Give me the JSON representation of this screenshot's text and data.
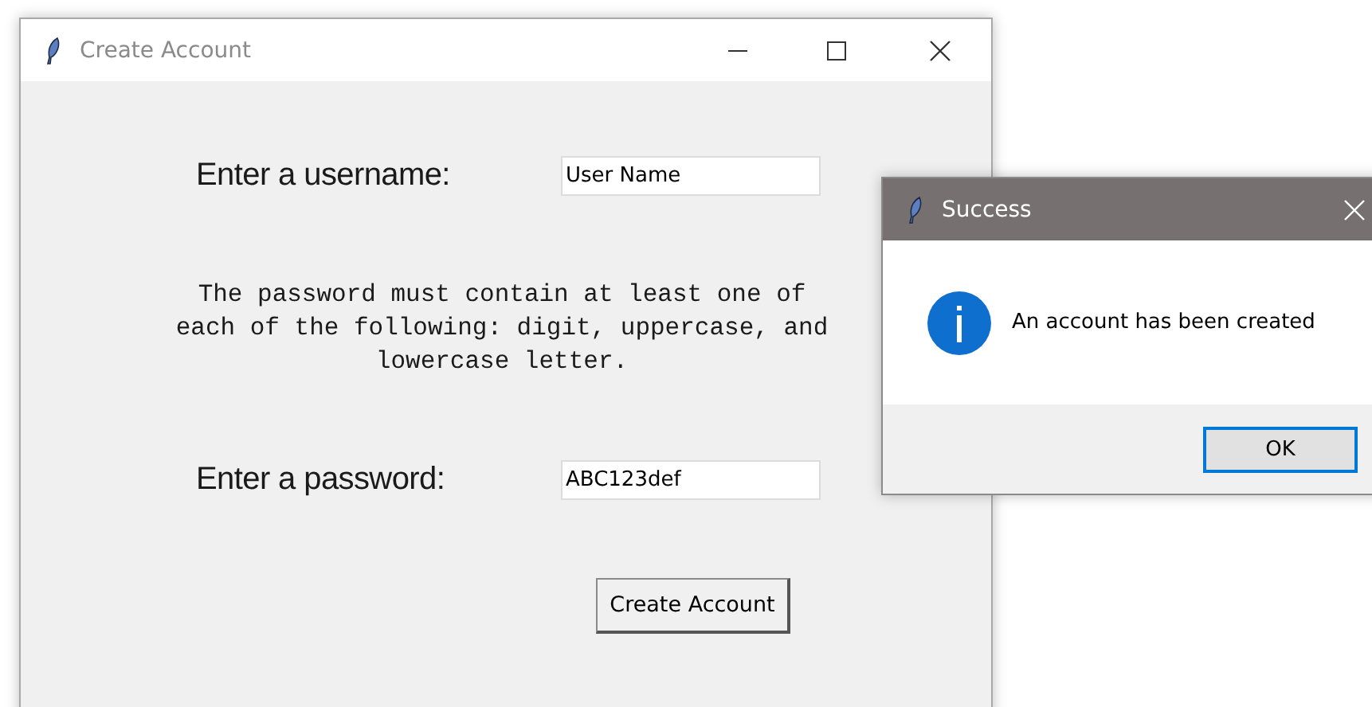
{
  "main_window": {
    "title": "Create Account",
    "active": false,
    "fields": [
      {
        "label": "Enter a username:",
        "value": "User Name"
      },
      {
        "label": "Enter a password:",
        "value": "ABC123def"
      }
    ],
    "note": "The password must contain at least one of each of the following: digit, uppercase, and lowercase letter.",
    "button": "Create Account"
  },
  "dialog": {
    "title": "Success",
    "active": true,
    "message": "An account has been created",
    "button": {
      "label": "OK",
      "focused": true
    }
  }
}
